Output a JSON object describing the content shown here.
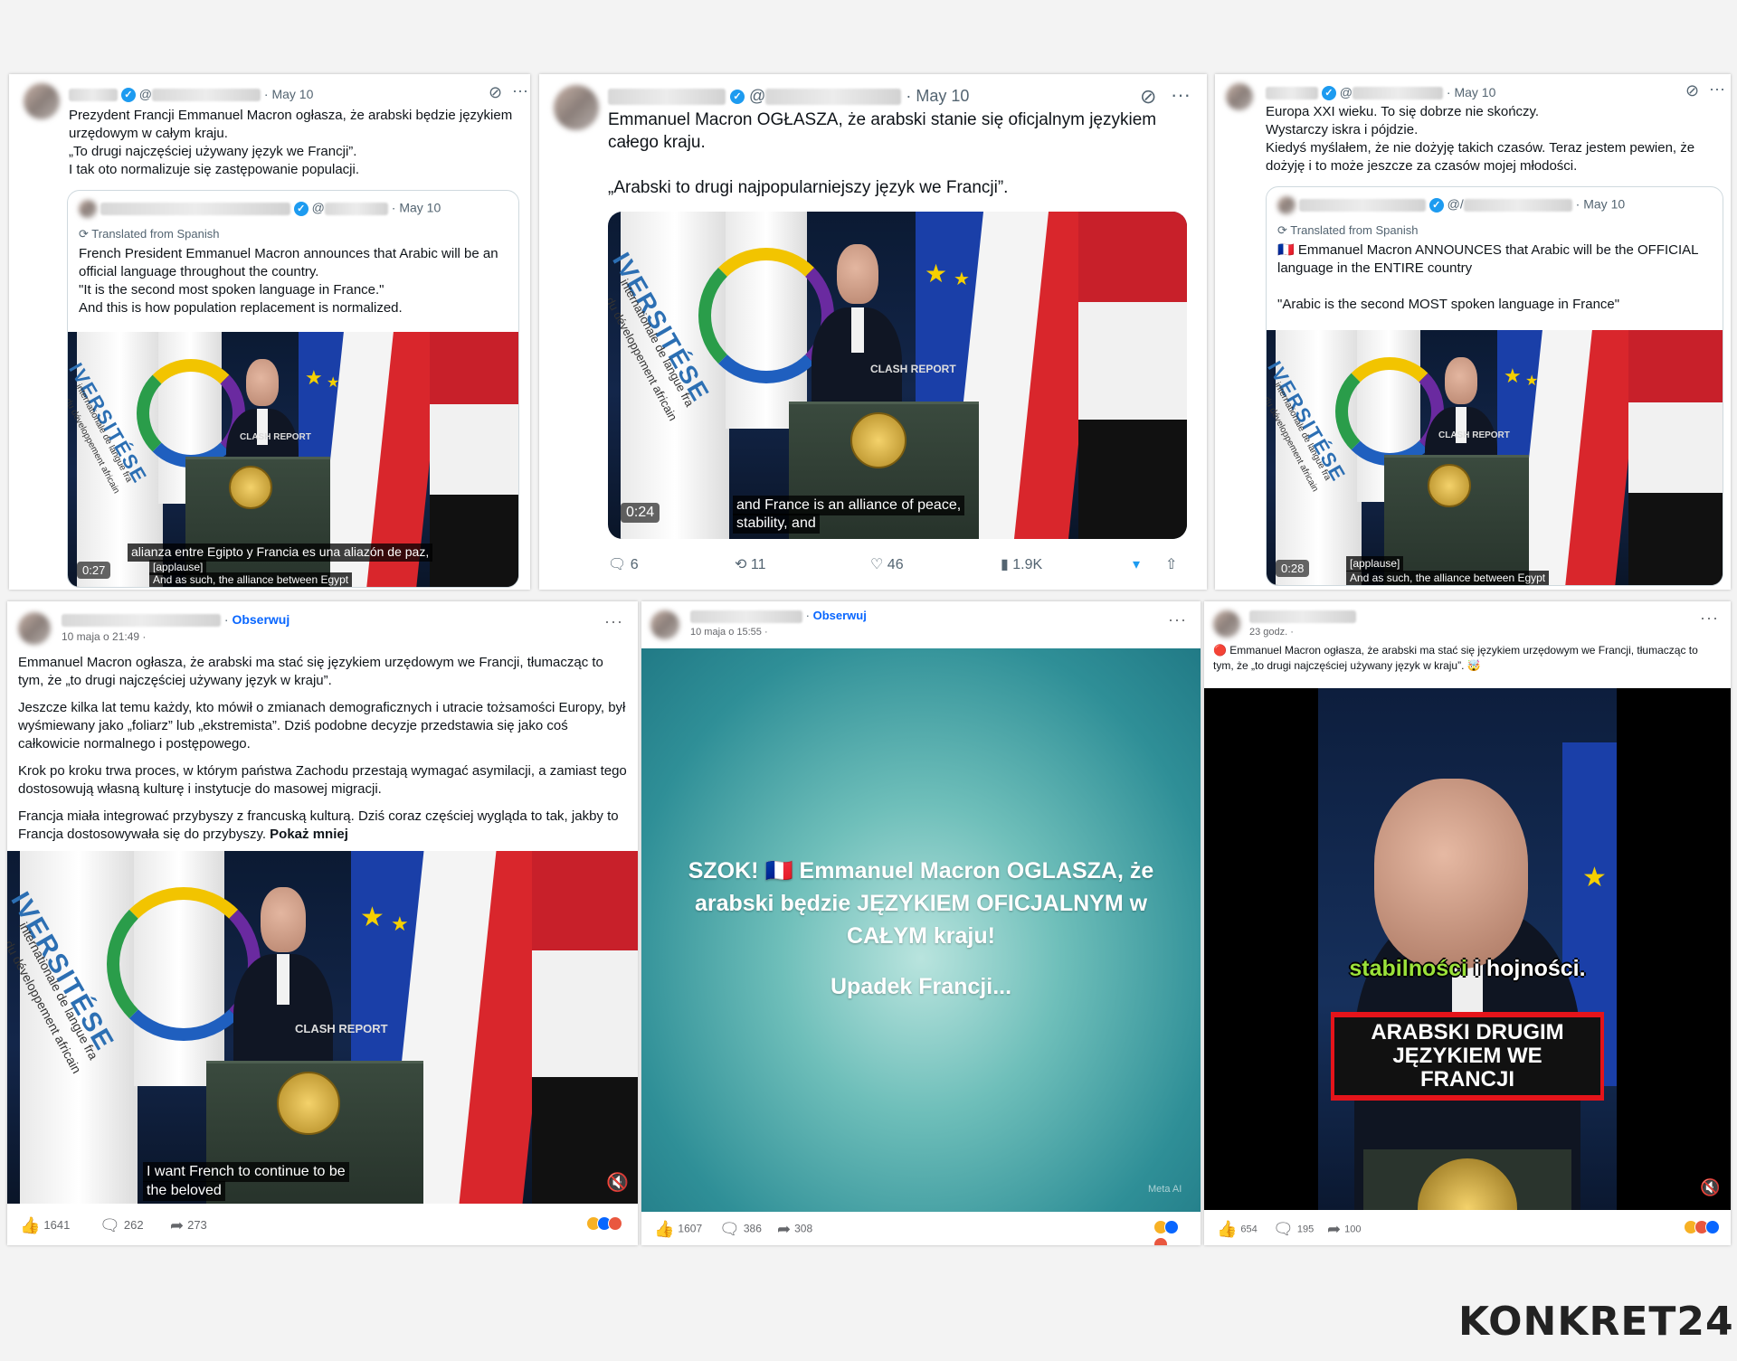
{
  "tw1": {
    "date": "May 10",
    "text": [
      "Prezydent Francji Emmanuel Macron ogłasza, że arabski będzie językiem",
      "urzędowym w całym kraju.",
      "„To drugi najczęściej używany język we Francji”.",
      "I tak oto normalizuje się zastępowanie populacji."
    ],
    "quote_date": "May 10",
    "translated": "Translated from Spanish",
    "quote_text": [
      "French President Emmanuel Macron announces that Arabic will be an",
      "official language throughout the country.",
      "\"It is the second most spoken language in France.\"",
      "And this is how population replacement is normalized."
    ],
    "time": "0:27",
    "sub1": "alianza entre Egipto y Francia es una aliazón de paz,",
    "sub2": "[applause]",
    "sub3": "And as such, the alliance between Egypt"
  },
  "tw2": {
    "date": "May 10",
    "text": [
      "Emmanuel Macron OGŁASZA, że arabski stanie się oficjalnym językiem",
      "całego kraju.",
      "",
      "„Arabski to drugi najpopularniejszy język we Francji”."
    ],
    "time": "0:24",
    "sub1": "and France is an alliance of peace,",
    "sub2": "stability, and",
    "replies": "6",
    "retweets": "11",
    "likes": "46",
    "views": "1.9K"
  },
  "tw3": {
    "date": "May 10",
    "text": [
      "Europa XXI wieku. To się dobrze nie skończy.",
      "Wystarczy iskra i pójdzie.",
      "Kiedyś myślałem, że nie dożyję takich czasów. Teraz jestem pewien, że",
      "dożyję i to może jeszcze za czasów mojej młodości."
    ],
    "quote_date": "May 10",
    "translated": "Translated from Spanish",
    "quote_text": [
      "🇫🇷 Emmanuel Macron ANNOUNCES that Arabic will be the OFFICIAL",
      "language in the ENTIRE country",
      "",
      "\"Arabic is the second MOST spoken language in France\""
    ],
    "time": "0:28",
    "sub2": "[applause]",
    "sub3": "And as such, the alliance between Egypt"
  },
  "fb1": {
    "follow": "Obserwuj",
    "date": "10 maja o 21:49 ·",
    "paragraphs": [
      "Emmanuel Macron ogłasza, że arabski ma stać się językiem urzędowym we Francji, tłumacząc to tym, że „to drugi najczęściej używany język w kraju”.",
      "Jeszcze kilka lat temu każdy, kto mówił o zmianach demograficznych i utracie tożsamości Europy, był wyśmiewany jako „foliarz” lub „ekstremista”. Dziś podobne decyzje przedstawia się jako coś całkowicie normalnego i postępowego.",
      "Krok po kroku trwa proces, w którym państwa Zachodu przestają wymagać asymilacji, a zamiast tego dostosowują własną kulturę i instytucje do masowej migracji.",
      "Francja miała integrować przybyszy z francuską kulturą. Dziś coraz częściej wygląda to tak, jakby to Francja dostosowywała się do przybyszy."
    ],
    "show_less": "Pokaż mniej",
    "sub1": "I want French to continue to be",
    "sub2": "the beloved",
    "likes": "1641",
    "comments": "262",
    "shares": "273"
  },
  "fb2": {
    "follow": "Obserwuj",
    "date": "10 maja o 15:55 ·",
    "headline": "SZOK! 🇫🇷 Emmanuel Macron OGLASZA, że arabski będzie JĘZYKIEM OFICJALNYM w CAŁYM kraju!",
    "subline": "Upadek Francji...",
    "meta_ai": "Meta AI",
    "likes": "1607",
    "comments": "386",
    "shares": "308"
  },
  "fb3": {
    "date": "23 godz. ·",
    "text": "🔴 Emmanuel Macron ogłasza, że arabski ma stać się językiem urzędowym we Francji, tłumacząc to tym, że „to drugi najczęściej używany język w kraju”. 🤯",
    "caption1a": "stabilności",
    "caption1b": " i hojności.",
    "banner": [
      "ARABSKI DRUGIM",
      "JĘZYKIEM WE",
      "FRANCJI"
    ],
    "likes": "654",
    "comments": "195",
    "shares": "100"
  },
  "watermark": "CLASH REPORT",
  "university": "IVERSITÉSE",
  "university_sub1": "internationale de langue fra",
  "university_sub2": "du développement africain",
  "logo": "KONKRET24"
}
